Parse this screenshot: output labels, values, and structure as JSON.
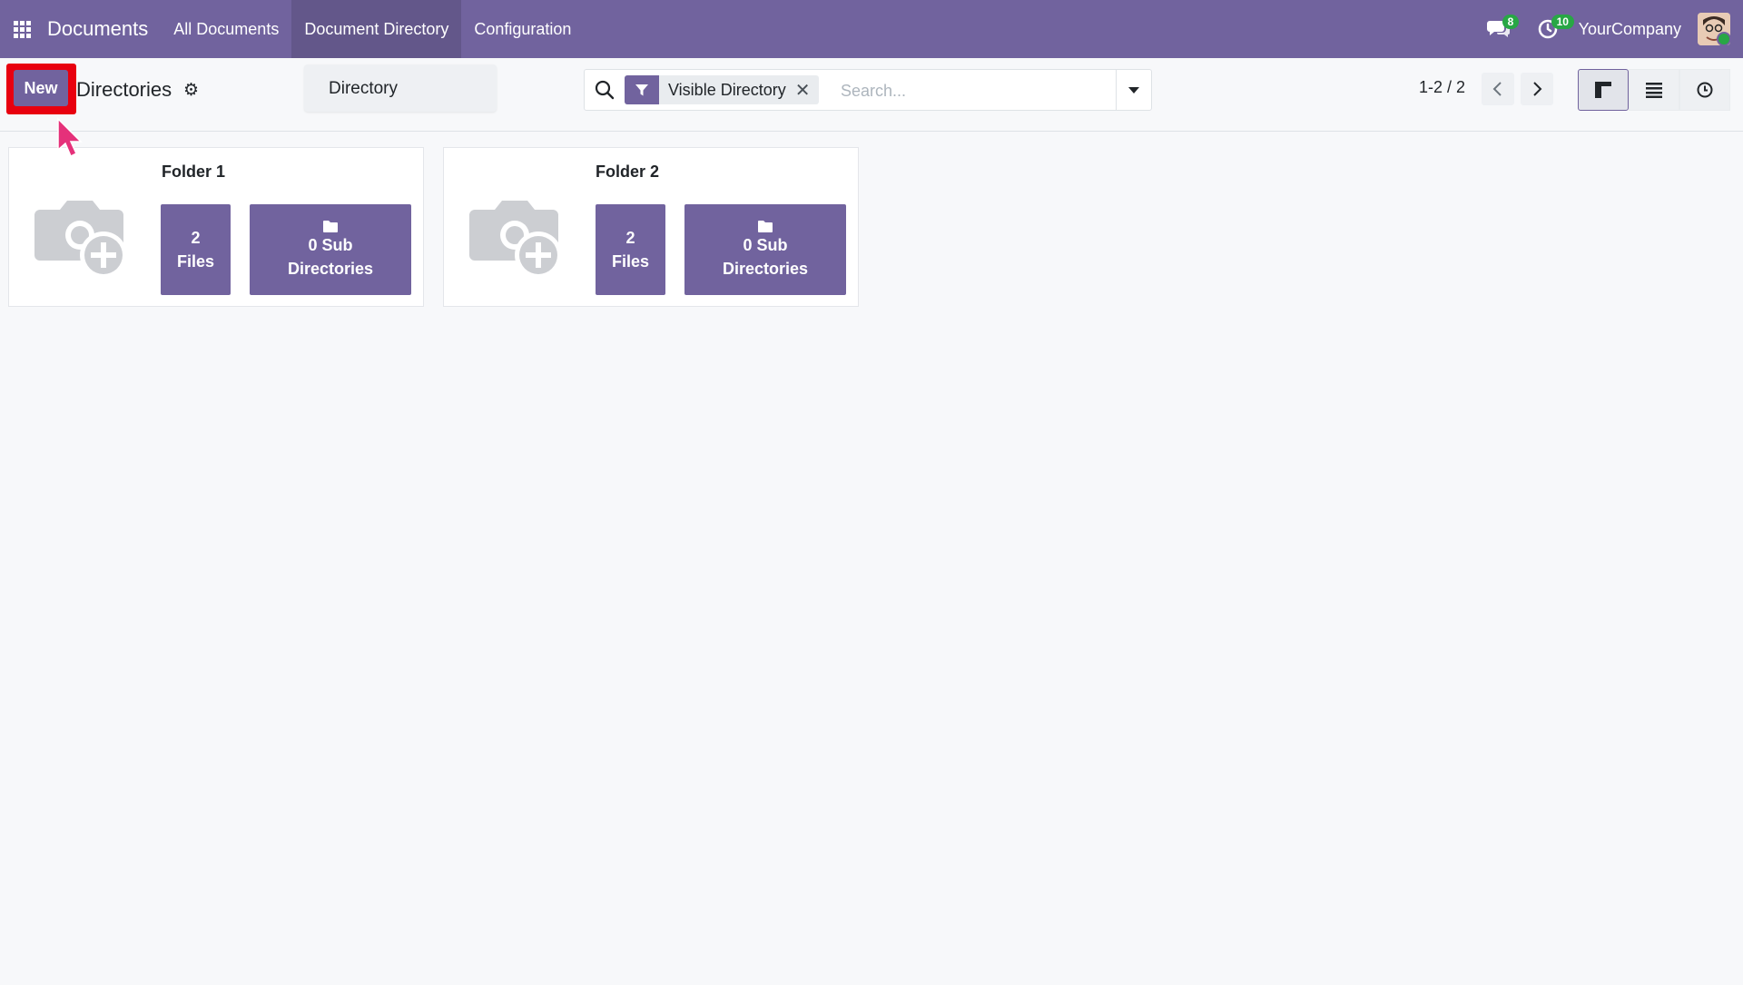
{
  "navbar": {
    "app_name": "Documents",
    "menu": [
      {
        "label": "All Documents"
      },
      {
        "label": "Document Directory"
      },
      {
        "label": "Configuration"
      }
    ],
    "messages_count": "8",
    "activities_count": "10",
    "company": "YourCompany"
  },
  "control": {
    "new_label": "New",
    "title": "Directories",
    "dropdown_item": "Directory",
    "facet_label": "Visible Directory",
    "search_placeholder": "Search...",
    "pager": "1-2 / 2"
  },
  "kanban": [
    {
      "title": "Folder 1",
      "files_count": "2",
      "files_label": "Files",
      "sub_count_label": "0 Sub",
      "sub_label": "Directories"
    },
    {
      "title": "Folder 2",
      "files_count": "2",
      "files_label": "Files",
      "sub_count_label": "0 Sub",
      "sub_label": "Directories"
    }
  ],
  "colors": {
    "brand": "#71639e",
    "highlight": "#e8000f",
    "badge": "#28a745",
    "cursor": "#e5317a"
  }
}
